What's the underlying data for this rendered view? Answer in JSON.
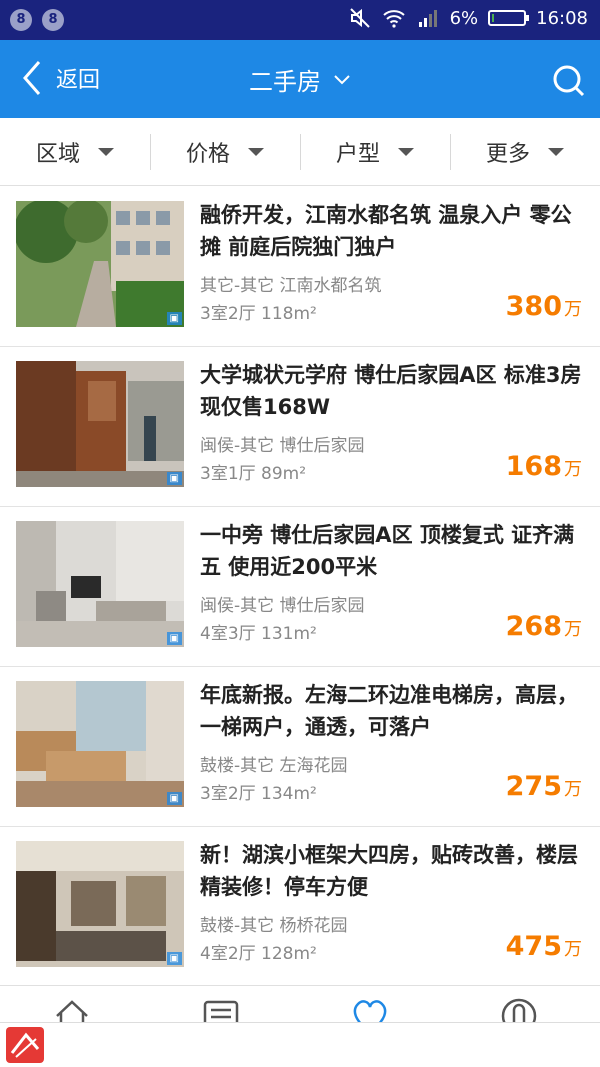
{
  "status_bar": {
    "battery": "6%",
    "time": "16:08",
    "battery_level": 0.06,
    "notification_icons": [
      "notification-icon",
      "notification-icon"
    ]
  },
  "nav": {
    "back_label": "返回",
    "title": "二手房"
  },
  "filters": [
    {
      "label": "区域"
    },
    {
      "label": "价格"
    },
    {
      "label": "户型"
    },
    {
      "label": "更多"
    }
  ],
  "listings": [
    {
      "title": "融侨开发，江南水都名筑 温泉入户 零公摊 前庭后院独门独户",
      "area": "其它-其它 江南水都名筑",
      "rooms": "3室2厅  118m²",
      "price": "380",
      "unit": "万"
    },
    {
      "title": "大学城状元学府 博仕后家园A区 标准3房 现仅售168W",
      "area": "闽侯-其它 博仕后家园",
      "rooms": "3室1厅  89m²",
      "price": "168",
      "unit": "万"
    },
    {
      "title": "一中旁 博仕后家园A区 顶楼复式 证齐满五 使用近200平米",
      "area": "闽侯-其它 博仕后家园",
      "rooms": "4室3厅  131m²",
      "price": "268",
      "unit": "万"
    },
    {
      "title": "年底新报。左海二环边准电梯房，高层，一梯两户，通透，可落户",
      "area": "鼓楼-其它 左海花园",
      "rooms": "3室2厅  134m²",
      "price": "275",
      "unit": "万"
    },
    {
      "title": "新！湖滨小框架大四房，贴砖改善，楼层精装修！停车方便",
      "area": "鼓楼-其它 杨桥花园",
      "rooms": "4室2厅  128m²",
      "price": "475",
      "unit": "万"
    }
  ],
  "tabs": [
    "home-icon",
    "list-icon",
    "heart-icon",
    "user-icon"
  ],
  "colors": {
    "status_bar": "#1a237e",
    "nav_bar": "#1e88e5",
    "price": "#f57c00"
  }
}
